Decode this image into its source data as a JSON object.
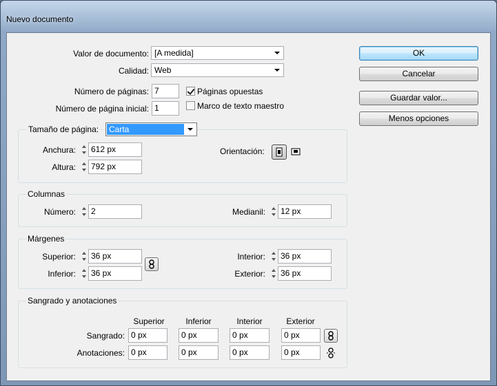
{
  "window": {
    "title": "Nuevo documento"
  },
  "doc": {
    "preset_label": "Valor de documento:",
    "preset_value": "[A medida]",
    "intent_label": "Calidad:",
    "intent_value": "Web",
    "pages_label": "Número de páginas:",
    "pages_value": "7",
    "start_page_label": "Número de página inicial:",
    "start_page_value": "1",
    "facing_pages_label": "Páginas opuestas",
    "facing_pages_checked": true,
    "master_text_frame_label": "Marco de texto maestro",
    "master_text_frame_checked": false
  },
  "page_size": {
    "label": "Tamaño de página:",
    "value": "Carta",
    "width_label": "Anchura:",
    "width_value": "612 px",
    "height_label": "Altura:",
    "height_value": "792 px",
    "orientation_label": "Orientación:"
  },
  "columns": {
    "title": "Columnas",
    "number_label": "Número:",
    "number_value": "2",
    "gutter_label": "Medianil:",
    "gutter_value": "12 px"
  },
  "margins": {
    "title": "Márgenes",
    "top_label": "Superior:",
    "top_value": "36 px",
    "bottom_label": "Inferior:",
    "bottom_value": "36 px",
    "inside_label": "Interior:",
    "inside_value": "36 px",
    "outside_label": "Exterior:",
    "outside_value": "36 px"
  },
  "bleed": {
    "title": "Sangrado y anotaciones",
    "headers": [
      "Superior",
      "Inferior",
      "Interior",
      "Exterior"
    ],
    "bleed_label": "Sangrado:",
    "bleed_values": [
      "0 px",
      "0 px",
      "0 px",
      "0 px"
    ],
    "slug_label": "Anotaciones:",
    "slug_values": [
      "0 px",
      "0 px",
      "0 px",
      "0 px"
    ]
  },
  "buttons": {
    "ok": "OK",
    "cancel": "Cancelar",
    "save_preset": "Guardar valor...",
    "fewer_options": "Menos opciones"
  },
  "colors": {
    "selection": "#3399ff",
    "default_button_border": "#3c7fb1"
  }
}
